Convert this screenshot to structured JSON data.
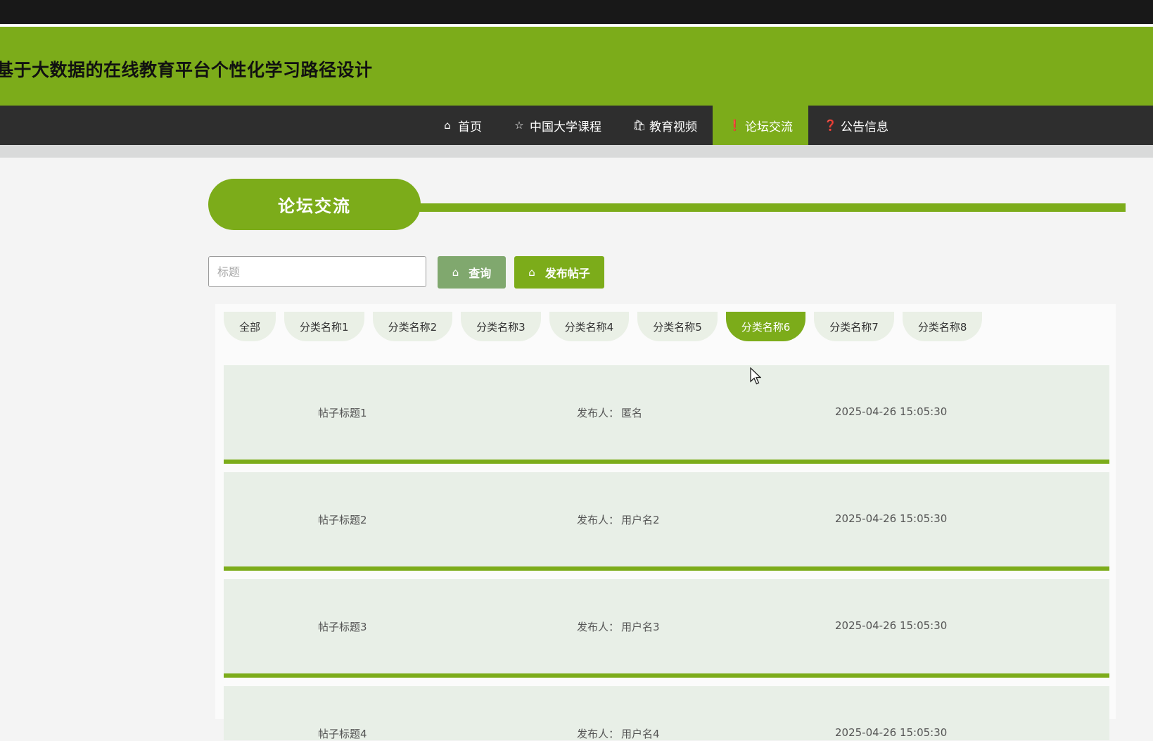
{
  "header": {
    "title": "基于大数据的在线教育平台个性化学习路径设计"
  },
  "nav": {
    "items": [
      {
        "label": "首页",
        "icon": "home-icon",
        "active": false
      },
      {
        "label": "中国大学课程",
        "icon": "star-icon",
        "active": false
      },
      {
        "label": "教育视频",
        "icon": "bag-icon",
        "active": false
      },
      {
        "label": "论坛交流",
        "icon": "alert-icon",
        "active": true
      },
      {
        "label": "公告信息",
        "icon": "question-icon",
        "active": false
      }
    ]
  },
  "section": {
    "title": "论坛交流"
  },
  "search": {
    "placeholder": "标题",
    "value": "",
    "query_label": "查询",
    "post_label": "发布帖子"
  },
  "categories": [
    {
      "label": "全部",
      "active": false
    },
    {
      "label": "分类名称1",
      "active": false
    },
    {
      "label": "分类名称2",
      "active": false
    },
    {
      "label": "分类名称3",
      "active": false
    },
    {
      "label": "分类名称4",
      "active": false
    },
    {
      "label": "分类名称5",
      "active": false
    },
    {
      "label": "分类名称6",
      "active": true
    },
    {
      "label": "分类名称7",
      "active": false
    },
    {
      "label": "分类名称8",
      "active": false
    }
  ],
  "posts": [
    {
      "title": "帖子标题1",
      "author_label": "发布人：",
      "author": "匿名",
      "time": "2025-04-26 15:05:30"
    },
    {
      "title": "帖子标题2",
      "author_label": "发布人：",
      "author": "用户名2",
      "time": "2025-04-26 15:05:30"
    },
    {
      "title": "帖子标题3",
      "author_label": "发布人：",
      "author": "用户名3",
      "time": "2025-04-26 15:05:30"
    },
    {
      "title": "帖子标题4",
      "author_label": "发布人：",
      "author": "用户名4",
      "time": "2025-04-26 15:05:30"
    }
  ],
  "colors": {
    "accent": "#7cac1a",
    "nav_bg": "#2e2e2e",
    "row_bg": "#e8efe7"
  }
}
